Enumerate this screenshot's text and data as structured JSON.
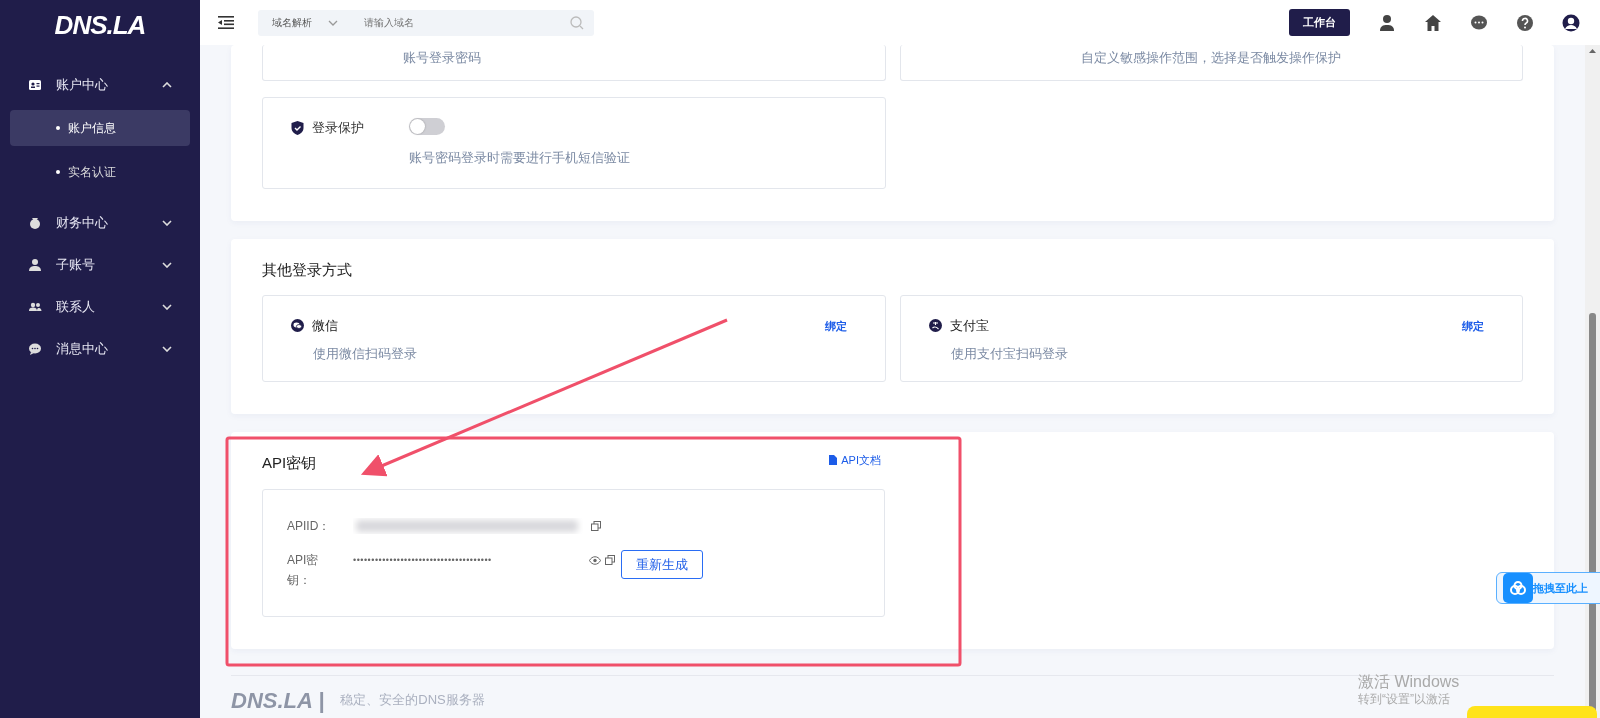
{
  "logo": "DNS.LA",
  "sidebar": {
    "items": [
      {
        "label": "账户中心",
        "expanded": true,
        "children": [
          {
            "label": "账户信息",
            "selected": true
          },
          {
            "label": "实名认证",
            "selected": false
          }
        ]
      },
      {
        "label": "财务中心",
        "expanded": false
      },
      {
        "label": "子账号",
        "expanded": false
      },
      {
        "label": "联系人",
        "expanded": false
      },
      {
        "label": "消息中心",
        "expanded": false
      }
    ]
  },
  "topbar": {
    "search_scope": "域名解析",
    "search": {
      "placeholder": "请输入域名"
    },
    "workbench_button": "工作台"
  },
  "security": {
    "items": [
      {
        "kind": "plain",
        "desc": "账号登录密码"
      },
      {
        "kind": "plain",
        "desc": "自定义敏感操作范围，选择是否触发操作保护"
      },
      {
        "kind": "toggle",
        "title": "登录保护",
        "on": false,
        "desc": "账号密码登录时需要进行手机短信验证"
      }
    ]
  },
  "other_login": {
    "title": "其他登录方式",
    "methods": [
      {
        "name": "微信",
        "desc": "使用微信扫码登录",
        "action": "绑定"
      },
      {
        "name": "支付宝",
        "desc": "使用支付宝扫码登录",
        "action": "绑定"
      }
    ]
  },
  "api_key": {
    "title": "API密钥",
    "doc_link": "API文档",
    "fields": [
      {
        "kind": "id",
        "label": "APIID："
      },
      {
        "kind": "secret",
        "label": "API密钥：",
        "value": "••••••••••••••••••••••••••••••••••••••"
      }
    ],
    "regenerate_button": "重新生成"
  },
  "footer": {
    "logo": "DNS.LA |",
    "slogan": "稳定、安全的DNS服务器"
  },
  "drag_widget": {
    "label": "拖拽至此上"
  },
  "os_notice": {
    "title": "激活 Windows",
    "text": "转到“设置”以激活"
  }
}
